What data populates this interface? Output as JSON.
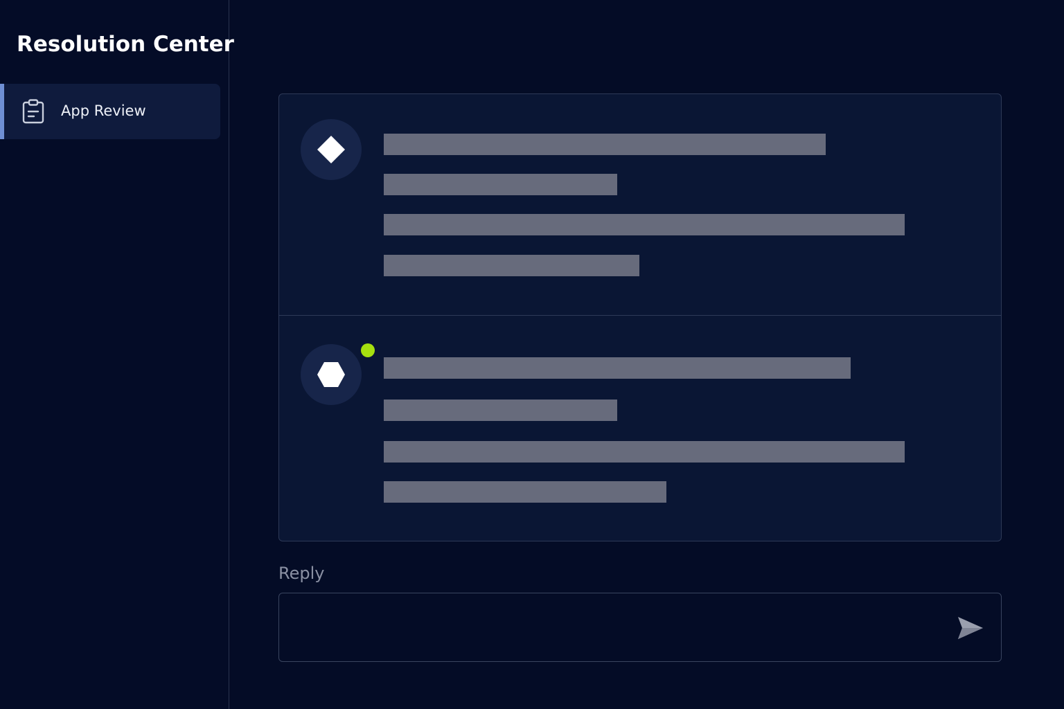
{
  "sidebar": {
    "title": "Resolution Center",
    "items": [
      {
        "label": "App Review",
        "icon": "clipboard-icon",
        "active": true
      }
    ]
  },
  "thread": {
    "messages": [
      {
        "avatar_icon": "diamond-icon",
        "online": false,
        "text_lines": 4
      },
      {
        "avatar_icon": "hexagon-icon",
        "online": true,
        "text_lines": 4
      }
    ]
  },
  "reply": {
    "label": "Reply",
    "value": "",
    "send_icon": "send-icon"
  },
  "colors": {
    "background": "#040c26",
    "active_item": "#0f1b3d",
    "accent": "#6f8fd4",
    "online": "#a6e00f",
    "redacted_text": "#676b7c"
  }
}
